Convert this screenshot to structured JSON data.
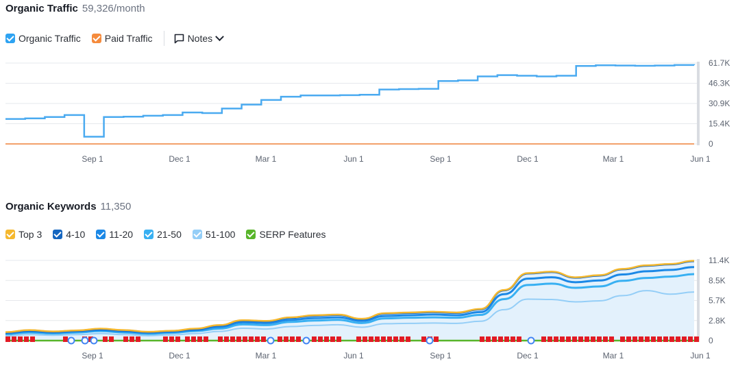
{
  "traffic": {
    "title": "Organic Traffic",
    "value": "59,326/month",
    "legend": [
      {
        "label": "Organic Traffic",
        "color": "#2ea3f2"
      },
      {
        "label": "Paid Traffic",
        "color": "#f58b3d"
      }
    ],
    "notes_label": "Notes"
  },
  "keywords": {
    "title": "Organic Keywords",
    "value": "11,350",
    "legend": [
      {
        "label": "Top 3",
        "color": "#f5b82e"
      },
      {
        "label": "4-10",
        "color": "#1566c0"
      },
      {
        "label": "11-20",
        "color": "#1b88e6"
      },
      {
        "label": "21-50",
        "color": "#38b0f2"
      },
      {
        "label": "51-100",
        "color": "#94cef7"
      },
      {
        "label": "SERP Features",
        "color": "#58b52a"
      }
    ]
  },
  "chart_data": [
    {
      "type": "line",
      "x_ticks": [
        "Sep 1",
        "Dec 1",
        "Mar 1",
        "Jun 1",
        "Sep 1",
        "Dec 1",
        "Mar 1",
        "Jun 1"
      ],
      "y_ticks": [
        "61.7K",
        "46.3K",
        "30.9K",
        "15.4K",
        "0"
      ],
      "ylim": [
        0,
        61700
      ],
      "series": [
        {
          "color": "#4aaaf0",
          "values": [
            19000,
            19500,
            20500,
            22000,
            5500,
            20500,
            20800,
            21500,
            22000,
            24000,
            23500,
            27000,
            30000,
            33500,
            36000,
            37000,
            37000,
            37200,
            37500,
            41500,
            41800,
            42000,
            48000,
            48500,
            51500,
            52500,
            52000,
            51500,
            52000,
            59500,
            60000,
            59800,
            59600,
            59800,
            60200,
            60100
          ]
        },
        {
          "color": "#f3a06a",
          "values": [
            0,
            0,
            0,
            0,
            0,
            0,
            0,
            0,
            0,
            0,
            0,
            0,
            0,
            0,
            0,
            0,
            0,
            0,
            0,
            0,
            0,
            0,
            0,
            0,
            0,
            0,
            0,
            0,
            0,
            0,
            0,
            0,
            0,
            0,
            0,
            0
          ]
        }
      ]
    },
    {
      "type": "area",
      "x_ticks": [
        "Sep 1",
        "Dec 1",
        "Mar 1",
        "Jun 1",
        "Sep 1",
        "Dec 1",
        "Mar 1",
        "Jun 1"
      ],
      "y_ticks": [
        "11.4K",
        "8.5K",
        "5.7K",
        "2.8K",
        "0"
      ],
      "ylim": [
        0,
        11400
      ],
      "series": [
        {
          "name": "Top 3",
          "color": "#f5b82e",
          "values": [
            1200,
            1500,
            1300,
            1450,
            1700,
            1500,
            1250,
            1400,
            1700,
            2200,
            2900,
            2800,
            3300,
            3600,
            3700,
            3100,
            3900,
            4000,
            4100,
            4000,
            4500,
            7200,
            9600,
            9800,
            9000,
            9300,
            10200,
            10700,
            10900,
            11350
          ]
        },
        {
          "name": "4-10",
          "color": "#1566c0",
          "values": [
            1150,
            1450,
            1250,
            1400,
            1650,
            1450,
            1200,
            1350,
            1650,
            2150,
            2850,
            2750,
            3250,
            3550,
            3650,
            3050,
            3850,
            3950,
            4050,
            3950,
            4450,
            7150,
            9550,
            9750,
            8950,
            9250,
            10150,
            10650,
            10850,
            11300
          ]
        },
        {
          "name": "11-20",
          "color": "#1b88e6",
          "values": [
            1050,
            1300,
            1150,
            1300,
            1500,
            1300,
            1100,
            1250,
            1500,
            1950,
            2600,
            2500,
            2950,
            3200,
            3300,
            2800,
            3500,
            3600,
            3700,
            3600,
            4050,
            6600,
            8800,
            9000,
            8300,
            8550,
            9400,
            9850,
            10050,
            10450
          ]
        },
        {
          "name": "21-50",
          "color": "#38b0f2",
          "values": [
            900,
            1150,
            1000,
            1150,
            1350,
            1150,
            950,
            1100,
            1350,
            1700,
            2300,
            2200,
            2650,
            2850,
            2950,
            2500,
            3150,
            3250,
            3300,
            3250,
            3650,
            5900,
            7900,
            8100,
            7500,
            7700,
            8500,
            8900,
            9100,
            9450
          ]
        },
        {
          "name": "51-100",
          "color": "#94cef7",
          "values": [
            650,
            850,
            750,
            850,
            1000,
            850,
            700,
            800,
            1000,
            1300,
            1750,
            1650,
            2000,
            2150,
            2250,
            1900,
            2400,
            2450,
            2500,
            2450,
            2750,
            4400,
            5900,
            5850,
            5500,
            5650,
            6400,
            7100,
            6600,
            6900
          ]
        }
      ]
    }
  ]
}
